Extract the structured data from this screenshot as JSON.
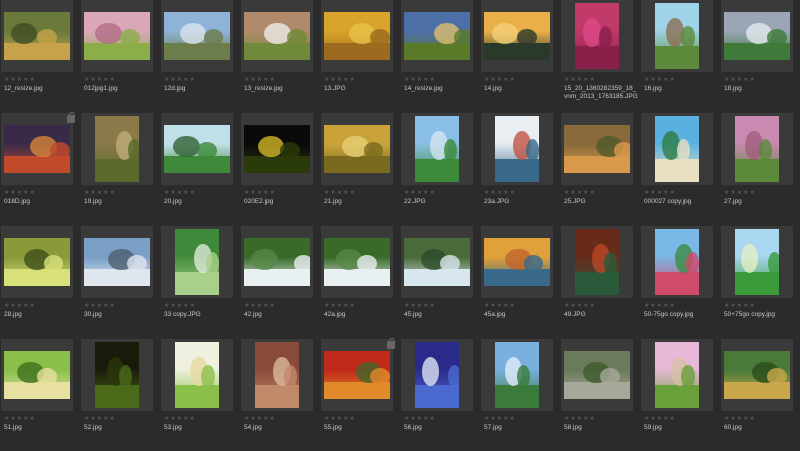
{
  "items": [
    {
      "name": "12_resize.jpg",
      "shape": "land",
      "c1": "#6a7a3a",
      "c2": "#c7a24a",
      "c3": "#3d4a22",
      "locked": false
    },
    {
      "name": "012jpg1.jpg",
      "shape": "land",
      "c1": "#d9a7b8",
      "c2": "#8cae4a",
      "c3": "#b06a86",
      "locked": false
    },
    {
      "name": "12d.jpg",
      "shape": "land",
      "c1": "#8fb3d6",
      "c2": "#6c7c4a",
      "c3": "#dfe6ee",
      "locked": false
    },
    {
      "name": "13_resize.jpg",
      "shape": "land",
      "c1": "#b08a6a",
      "c2": "#6e8a3a",
      "c3": "#f2f2f2",
      "locked": false
    },
    {
      "name": "13.JPG",
      "shape": "land",
      "c1": "#d9a42c",
      "c2": "#9c6b1f",
      "c3": "#e8c44a",
      "locked": false
    },
    {
      "name": "14_resize.jpg",
      "shape": "land",
      "c1": "#4d6fa8",
      "c2": "#5a7a2a",
      "c3": "#e6c36a",
      "locked": false
    },
    {
      "name": "14.jpg",
      "shape": "land",
      "c1": "#e9b04a",
      "c2": "#2a3a2a",
      "c3": "#f4d27a",
      "locked": false
    },
    {
      "name": "15_20_1360282359_18_vnm_2013_1763185.JPG",
      "shape": "port",
      "c1": "#c03a6a",
      "c2": "#8a1f4a",
      "c3": "#e04a8a",
      "locked": false
    },
    {
      "name": "16.jpg",
      "shape": "port",
      "c1": "#9fd4e8",
      "c2": "#5c8a3a",
      "c3": "#8a6a4a",
      "locked": false
    },
    {
      "name": "18.jpg",
      "shape": "land",
      "c1": "#9aa6b6",
      "c2": "#3f7a3a",
      "c3": "#e8eef2",
      "locked": false
    },
    {
      "name": "018D.jpg",
      "shape": "land",
      "c1": "#3a2a4a",
      "c2": "#c04a2a",
      "c3": "#e08a3a",
      "locked": true
    },
    {
      "name": "19.jpg",
      "shape": "port",
      "c1": "#8a7a4a",
      "c2": "#5a6a2a",
      "c3": "#c4b07a",
      "locked": false
    },
    {
      "name": "20.jpg",
      "shape": "land",
      "c1": "#bfe0e8",
      "c2": "#3f8a3a",
      "c3": "#2a5a2a",
      "locked": false
    },
    {
      "name": "020E2.jpg",
      "shape": "land",
      "c1": "#0a0a0a",
      "c2": "#2a3a0a",
      "c3": "#e0c02a",
      "locked": false
    },
    {
      "name": "21.jpg",
      "shape": "land",
      "c1": "#c9a23a",
      "c2": "#7a6a1f",
      "c3": "#e8d27a",
      "locked": false
    },
    {
      "name": "22.JPG",
      "shape": "port",
      "c1": "#8ac0e8",
      "c2": "#3a8a3a",
      "c3": "#d8e8f0",
      "locked": false
    },
    {
      "name": "23a.JPG",
      "shape": "port",
      "c1": "#e8eef2",
      "c2": "#3a6a8a",
      "c3": "#c04a3a",
      "locked": false
    },
    {
      "name": "25.JPG",
      "shape": "land",
      "c1": "#8a6a3a",
      "c2": "#d89a4a",
      "c3": "#4a5a2a",
      "locked": false
    },
    {
      "name": "000027 copy.jpg",
      "shape": "port",
      "c1": "#5ab0e0",
      "c2": "#e8e0c0",
      "c3": "#2a7a3a",
      "locked": false
    },
    {
      "name": "27.jpg",
      "shape": "port",
      "c1": "#c88ab0",
      "c2": "#5a8a3a",
      "c3": "#a05a7a",
      "locked": false
    },
    {
      "name": "28.jpg",
      "shape": "land",
      "c1": "#8a9a3a",
      "c2": "#d8e07a",
      "c3": "#3a4a1a",
      "locked": false
    },
    {
      "name": "30.jpg",
      "shape": "land",
      "c1": "#7aa0c8",
      "c2": "#e0e6ee",
      "c3": "#4a5a6a",
      "locked": false
    },
    {
      "name": "33 copy.JPG",
      "shape": "port",
      "c1": "#3f8a3a",
      "c2": "#a8d08a",
      "c3": "#e8f0e0",
      "locked": false
    },
    {
      "name": "42.jpg",
      "shape": "land",
      "c1": "#3a6a2a",
      "c2": "#e8f0f2",
      "c3": "#5a8a4a",
      "locked": false
    },
    {
      "name": "42a.jpg",
      "shape": "land",
      "c1": "#3a6a2a",
      "c2": "#e8f0f2",
      "c3": "#5a8a4a",
      "locked": false
    },
    {
      "name": "45.jpg",
      "shape": "land",
      "c1": "#4a6a3a",
      "c2": "#d8e6ee",
      "c3": "#2a4a2a",
      "locked": false
    },
    {
      "name": "45a.jpg",
      "shape": "land",
      "c1": "#e0a03a",
      "c2": "#3a6a8a",
      "c3": "#c0602a",
      "locked": false
    },
    {
      "name": "49.JPG",
      "shape": "port",
      "c1": "#6a2a1a",
      "c2": "#2a5a3a",
      "c3": "#c04a2a",
      "locked": false
    },
    {
      "name": "50-75go copy.jpg",
      "shape": "port",
      "c1": "#7ab8e8",
      "c2": "#d04a6a",
      "c3": "#3a8a3a",
      "locked": false
    },
    {
      "name": "50+75go copy.jpg",
      "shape": "port",
      "c1": "#a8d8f0",
      "c2": "#3a9a3a",
      "c3": "#e8f0c0",
      "locked": false
    },
    {
      "name": "51.jpg",
      "shape": "land",
      "c1": "#8ac04a",
      "c2": "#e8e0a0",
      "c3": "#3a6a1a",
      "locked": false
    },
    {
      "name": "52.jpg",
      "shape": "port",
      "c1": "#1a1a0a",
      "c2": "#4a6a1a",
      "c3": "#2a3a0a",
      "locked": false
    },
    {
      "name": "53.jpg",
      "shape": "port",
      "c1": "#f0f0e0",
      "c2": "#8ac04a",
      "c3": "#e8d8a0",
      "locked": false
    },
    {
      "name": "54.jpg",
      "shape": "port",
      "c1": "#8a4a3a",
      "c2": "#c08a6a",
      "c3": "#e0c0a0",
      "locked": false
    },
    {
      "name": "55.jpg",
      "shape": "land",
      "c1": "#c02a1a",
      "c2": "#e08a2a",
      "c3": "#3a6a2a",
      "locked": true
    },
    {
      "name": "56.jpg",
      "shape": "port",
      "c1": "#2a2a8a",
      "c2": "#4a6ad0",
      "c3": "#e8f0f8",
      "locked": false
    },
    {
      "name": "57.jpg",
      "shape": "port",
      "c1": "#7ab0e0",
      "c2": "#3a7a3a",
      "c3": "#e8f0f8",
      "locked": false
    },
    {
      "name": "58.jpg",
      "shape": "land",
      "c1": "#6a7a5a",
      "c2": "#a8a89a",
      "c3": "#3a5a2a",
      "locked": false
    },
    {
      "name": "59.jpg",
      "shape": "port",
      "c1": "#e8b8d8",
      "c2": "#6aa03a",
      "c3": "#d8c0a0",
      "locked": false
    },
    {
      "name": "60.jpg",
      "shape": "land",
      "c1": "#4a7a3a",
      "c2": "#c8a84a",
      "c3": "#2a4a1a",
      "locked": false
    }
  ],
  "rating_glyph": "★★★★★"
}
